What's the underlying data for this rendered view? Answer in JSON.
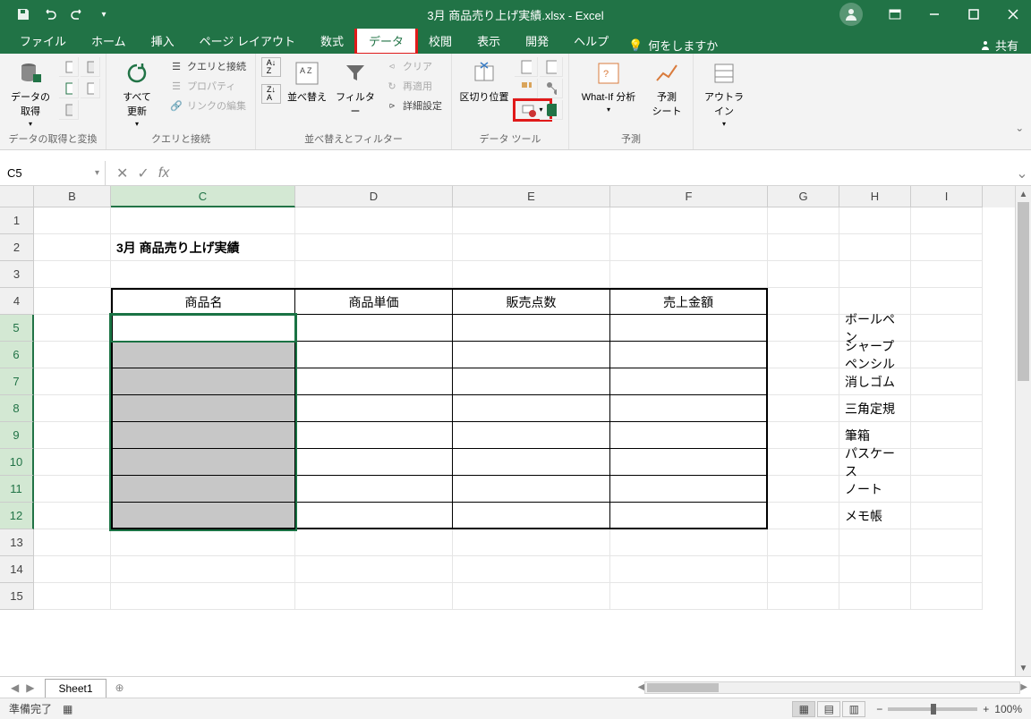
{
  "title": "3月 商品売り上げ実績.xlsx - Excel",
  "qat": {
    "save": "保存",
    "undo": "元に戻す",
    "redo": "やり直し"
  },
  "tabs": {
    "file": "ファイル",
    "home": "ホーム",
    "insert": "挿入",
    "page_layout": "ページ レイアウト",
    "formulas": "数式",
    "data": "データ",
    "review": "校閲",
    "view": "表示",
    "developer": "開発",
    "help": "ヘルプ",
    "tell_me": "何をしますか"
  },
  "share": "共有",
  "ribbon": {
    "get_transform": {
      "big": "データの\n取得",
      "label": "データの取得と変換"
    },
    "queries": {
      "big": "すべて\n更新",
      "items": [
        "クエリと接続",
        "プロパティ",
        "リンクの編集"
      ],
      "label": "クエリと接続"
    },
    "sort_filter": {
      "sort": "並べ替え",
      "filter": "フィルター",
      "clear": "クリア",
      "reapply": "再適用",
      "advanced": "詳細設定",
      "label": "並べ替えとフィルター"
    },
    "data_tools": {
      "text_to_columns": "区切り位置",
      "label": "データ ツール"
    },
    "forecast": {
      "whatif": "What-If 分析",
      "forecast_sheet": "予測\nシート",
      "label": "予測"
    },
    "outline": {
      "big": "アウトラ\nイン",
      "label": ""
    }
  },
  "namebox": "C5",
  "columns": [
    "B",
    "C",
    "D",
    "E",
    "F",
    "G",
    "H",
    "I"
  ],
  "row_numbers": [
    1,
    2,
    3,
    4,
    5,
    6,
    7,
    8,
    9,
    10,
    11,
    12,
    13,
    14,
    15
  ],
  "cells": {
    "C2": "3月 商品売り上げ実績",
    "C4": "商品名",
    "D4": "商品単価",
    "E4": "販売点数",
    "F4": "売上金額",
    "H5": "ボールペン",
    "H6": "シャープペンシル",
    "H7": "消しゴム",
    "H8": "三角定規",
    "H9": "筆箱",
    "H10": "パスケース",
    "H11": "ノート",
    "H12": "メモ帳"
  },
  "sheet": {
    "name": "Sheet1"
  },
  "status": {
    "ready": "準備完了",
    "zoom": "100%"
  },
  "selection": {
    "active": "C5",
    "range": "C5:C12"
  }
}
